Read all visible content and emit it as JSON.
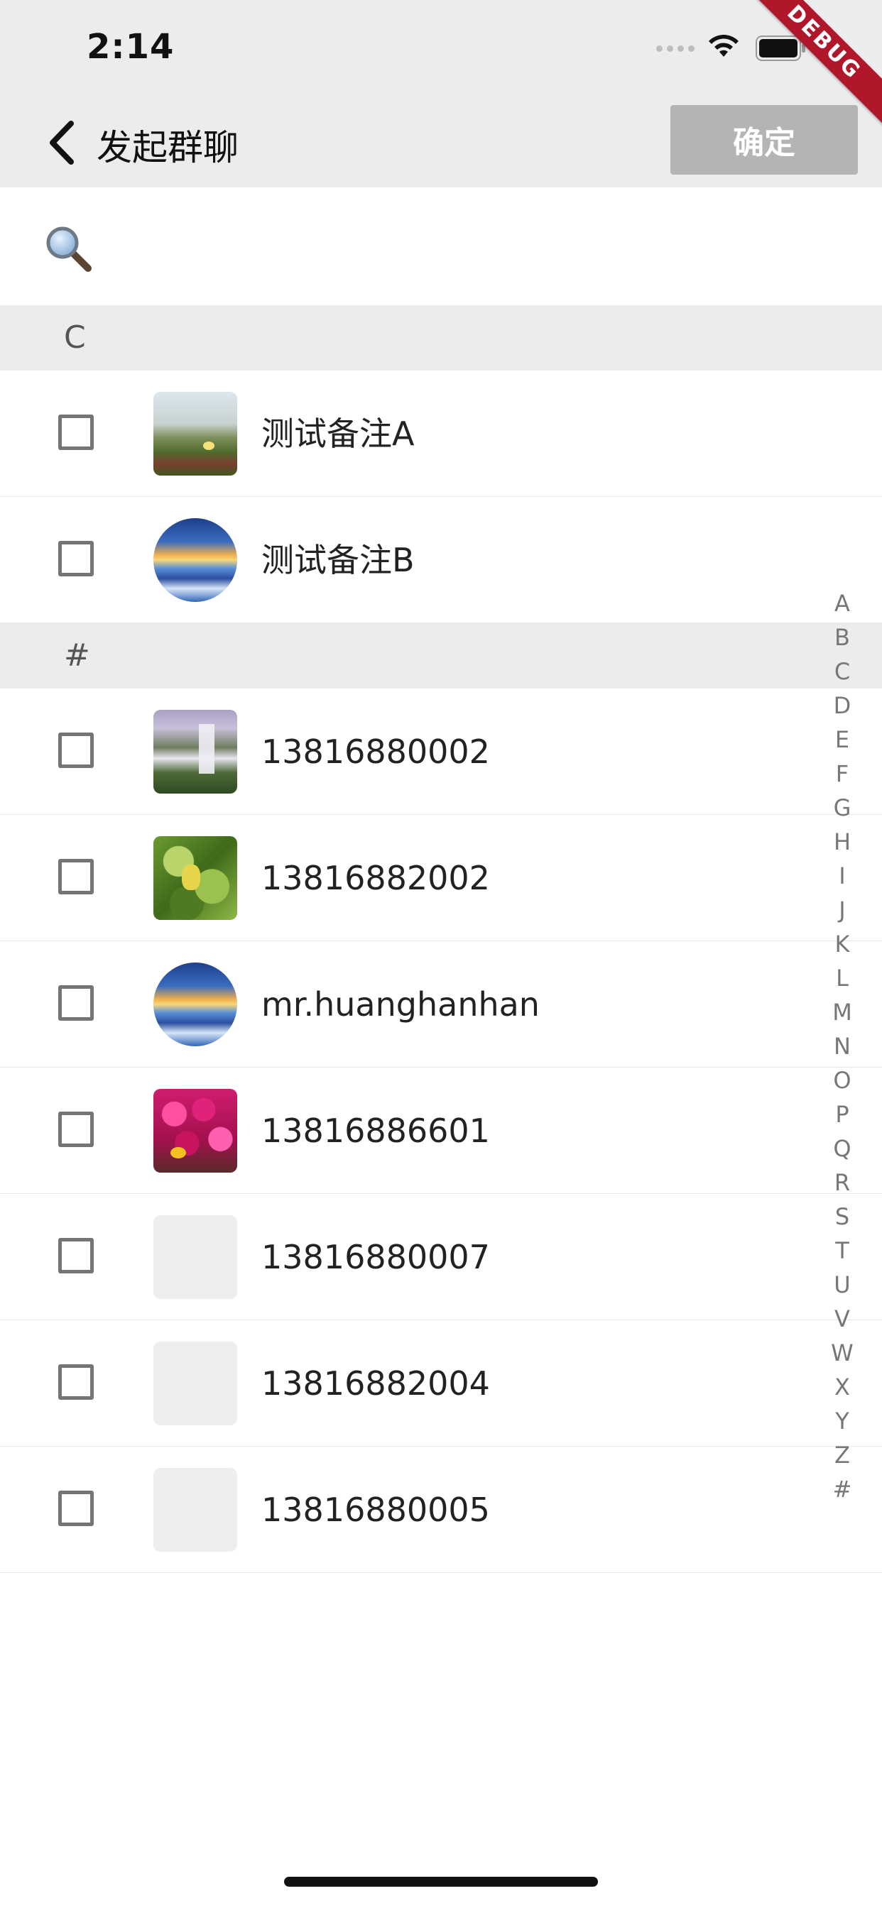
{
  "status_bar": {
    "time": "2:14"
  },
  "debug_banner": "DEBUG",
  "nav": {
    "title": "发起群聊",
    "confirm_label": "确定"
  },
  "search": {
    "placeholder": ""
  },
  "sections": [
    {
      "letter": "C",
      "contacts": [
        {
          "name": "测试备注A",
          "avatar": "field-photo"
        },
        {
          "name": "测试备注B",
          "avatar": "sunset-sea-photo"
        }
      ]
    },
    {
      "letter": "#",
      "contacts": [
        {
          "name": "13816880002",
          "avatar": "waterfall-photo"
        },
        {
          "name": "13816882002",
          "avatar": "leaves-photo"
        },
        {
          "name": "mr.huanghanhan",
          "avatar": "sunset-sea-photo"
        },
        {
          "name": "13816886601",
          "avatar": "flowers-photo"
        },
        {
          "name": "13816880007",
          "avatar": "blank"
        },
        {
          "name": "13816882004",
          "avatar": "blank"
        },
        {
          "name": "13816880005",
          "avatar": "blank"
        }
      ]
    }
  ],
  "index_letters": [
    "A",
    "B",
    "C",
    "D",
    "E",
    "F",
    "G",
    "H",
    "I",
    "J",
    "K",
    "L",
    "M",
    "N",
    "O",
    "P",
    "Q",
    "R",
    "S",
    "T",
    "U",
    "V",
    "W",
    "X",
    "Y",
    "Z",
    "#"
  ],
  "colors": {
    "header_bg": "#ececec",
    "confirm_disabled": "#b4b4b4",
    "debug_ribbon": "#b0172b"
  }
}
